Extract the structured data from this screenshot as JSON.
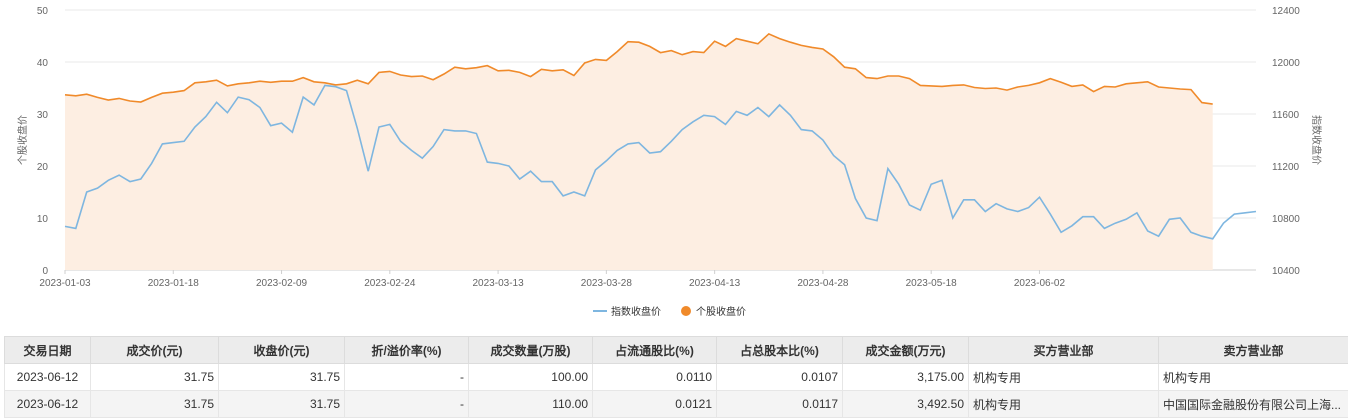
{
  "colors": {
    "index_line": "#7eb6e0",
    "stock_line": "#f08a2a",
    "stock_fill": "#fdeee2",
    "grid": "#e8e8e8",
    "header_bg": "#ececec"
  },
  "chart_data": {
    "type": "line",
    "left_axis": {
      "title": "个股收盘价",
      "min": 0,
      "max": 50,
      "ticks": [
        "0",
        "10",
        "20",
        "30",
        "40",
        "50"
      ]
    },
    "right_axis": {
      "title": "指数收盘价",
      "min": 10400,
      "max": 12400,
      "ticks": [
        "10400",
        "10800",
        "11200",
        "11600",
        "12000",
        "12400"
      ]
    },
    "x_tick_labels": [
      "2023-01-03",
      "2023-01-18",
      "2023-02-09",
      "2023-02-24",
      "2023-03-13",
      "2023-03-28",
      "2023-04-13",
      "2023-04-28",
      "2023-05-18",
      "2023-06-02"
    ],
    "x_tick_positions": [
      0,
      10,
      20,
      30,
      40,
      50,
      60,
      70,
      80,
      90
    ],
    "legend_position": "bottom-center",
    "grid": true,
    "series": [
      {
        "name": "指数收盘价",
        "axis": "right",
        "values": [
          10735,
          10720,
          11000,
          11030,
          11090,
          11130,
          11080,
          11100,
          11220,
          11370,
          11380,
          11390,
          11500,
          11580,
          11690,
          11610,
          11730,
          11710,
          11650,
          11510,
          11530,
          11460,
          11730,
          11670,
          11820,
          11810,
          11780,
          11490,
          11160,
          11500,
          11520,
          11390,
          11320,
          11260,
          11350,
          11480,
          11470,
          11470,
          11450,
          11230,
          11220,
          11200,
          11100,
          11160,
          11080,
          11080,
          10970,
          11000,
          10970,
          11170,
          11240,
          11320,
          11370,
          11380,
          11300,
          11310,
          11390,
          11480,
          11540,
          11590,
          11580,
          11520,
          11620,
          11590,
          11650,
          11580,
          11670,
          11590,
          11480,
          11470,
          11400,
          11280,
          11210,
          10950,
          10800,
          10780,
          11180,
          11060,
          10900,
          10860,
          11060,
          11090,
          10800,
          10940,
          10940,
          10850,
          10910,
          10870,
          10850,
          10880,
          10960,
          10830,
          10690,
          10740,
          10810,
          10810,
          10720,
          10760,
          10790,
          10840,
          10700,
          10660,
          10790,
          10800,
          10690,
          10660,
          10640,
          10760,
          10830,
          10840,
          10850
        ]
      },
      {
        "name": "个股收盘价",
        "axis": "left",
        "values": [
          33.7,
          33.5,
          33.8,
          33.2,
          32.7,
          33.0,
          32.5,
          32.3,
          33.2,
          34.0,
          34.2,
          34.5,
          36.0,
          36.2,
          36.5,
          35.4,
          35.8,
          36.0,
          36.3,
          36.1,
          36.3,
          36.3,
          37.0,
          36.2,
          36.0,
          35.6,
          35.8,
          36.5,
          35.8,
          38.0,
          38.2,
          37.5,
          37.2,
          37.3,
          36.6,
          37.7,
          39.0,
          38.7,
          38.9,
          39.3,
          38.3,
          38.4,
          38.0,
          37.2,
          38.6,
          38.3,
          38.5,
          37.4,
          39.8,
          40.5,
          40.3,
          42.0,
          43.9,
          43.8,
          43.0,
          41.8,
          42.2,
          41.4,
          42.0,
          41.8,
          44.0,
          43.0,
          44.5,
          44.0,
          43.5,
          45.4,
          44.5,
          43.8,
          43.2,
          42.8,
          42.5,
          41.0,
          39.0,
          38.7,
          37.0,
          36.8,
          37.3,
          37.3,
          36.8,
          35.5,
          35.4,
          35.3,
          35.5,
          35.6,
          35.1,
          34.9,
          35.0,
          34.6,
          35.2,
          35.5,
          36.0,
          36.8,
          36.1,
          35.3,
          35.6,
          34.3,
          35.3,
          35.2,
          35.8,
          36.0,
          36.2,
          35.2,
          35.0,
          34.8,
          34.7,
          32.2,
          31.9
        ]
      }
    ]
  },
  "legend": {
    "index_label": "指数收盘价",
    "stock_label": "个股收盘价"
  },
  "table": {
    "headers": [
      "交易日期",
      "成交价(元)",
      "收盘价(元)",
      "折/溢价率(%)",
      "成交数量(万股)",
      "占流通股比(%)",
      "占总股本比(%)",
      "成交金额(万元)",
      "买方营业部",
      "卖方营业部"
    ],
    "rows": [
      [
        "2023-06-12",
        "31.75",
        "31.75",
        "-",
        "100.00",
        "0.0110",
        "0.0107",
        "3,175.00",
        "机构专用",
        "机构专用"
      ],
      [
        "2023-06-12",
        "31.75",
        "31.75",
        "-",
        "110.00",
        "0.0121",
        "0.0117",
        "3,492.50",
        "机构专用",
        "中国国际金融股份有限公司上海..."
      ]
    ]
  }
}
